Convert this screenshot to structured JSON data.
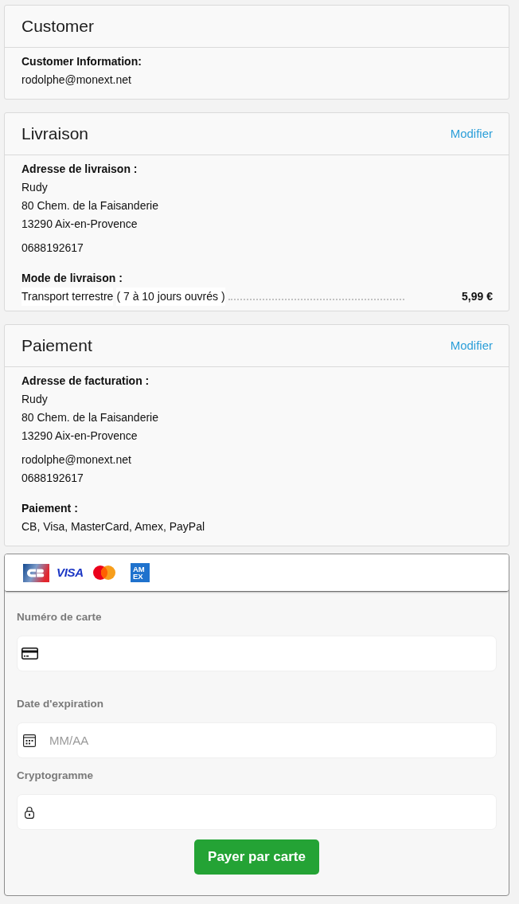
{
  "sections": [
    {
      "title": "Customer",
      "blocks": [
        {
          "kind": "info",
          "label": "Customer Information:",
          "groups": [
            [
              "rodolphe@monext.net"
            ]
          ]
        }
      ]
    },
    {
      "title": "Livraison",
      "action": "Modifier",
      "blocks": [
        {
          "kind": "info",
          "label": "Adresse de livraison :",
          "groups": [
            [
              "Rudy",
              "80 Chem. de la Faisanderie",
              "13290 Aix-en-Provence"
            ],
            [
              "0688192617"
            ]
          ]
        },
        {
          "kind": "shipping",
          "label": "Mode de livraison :",
          "method": "Transport terrestre",
          "delay": "( 7 à 10 jours ouvrés )",
          "price": "5,99 €"
        }
      ]
    },
    {
      "title": "Paiement",
      "action": "Modifier",
      "blocks": [
        {
          "kind": "info",
          "label": "Adresse de facturation :",
          "groups": [
            [
              "Rudy",
              "80 Chem. de la Faisanderie",
              "13290 Aix-en-Provence"
            ],
            [
              "rodolphe@monext.net",
              "0688192617"
            ]
          ]
        },
        {
          "kind": "info",
          "label": "Paiement :",
          "groups": [
            [
              "CB, Visa, MasterCard, Amex, PayPal"
            ]
          ]
        }
      ]
    }
  ],
  "card_form": {
    "brands": [
      {
        "kind": "cb"
      },
      {
        "kind": "visa",
        "text": "VISA"
      },
      {
        "kind": "mastercard"
      },
      {
        "kind": "amex",
        "lines": [
          "AM",
          "EX"
        ]
      }
    ],
    "fields": [
      {
        "kind": "card",
        "label": "Numéro de carte"
      },
      {
        "kind": "date",
        "label": "Date d'expiration",
        "placeholder": "MM/AA"
      },
      {
        "kind": "cvv",
        "label": "Cryptogramme"
      }
    ],
    "submit": "Payer par carte"
  }
}
